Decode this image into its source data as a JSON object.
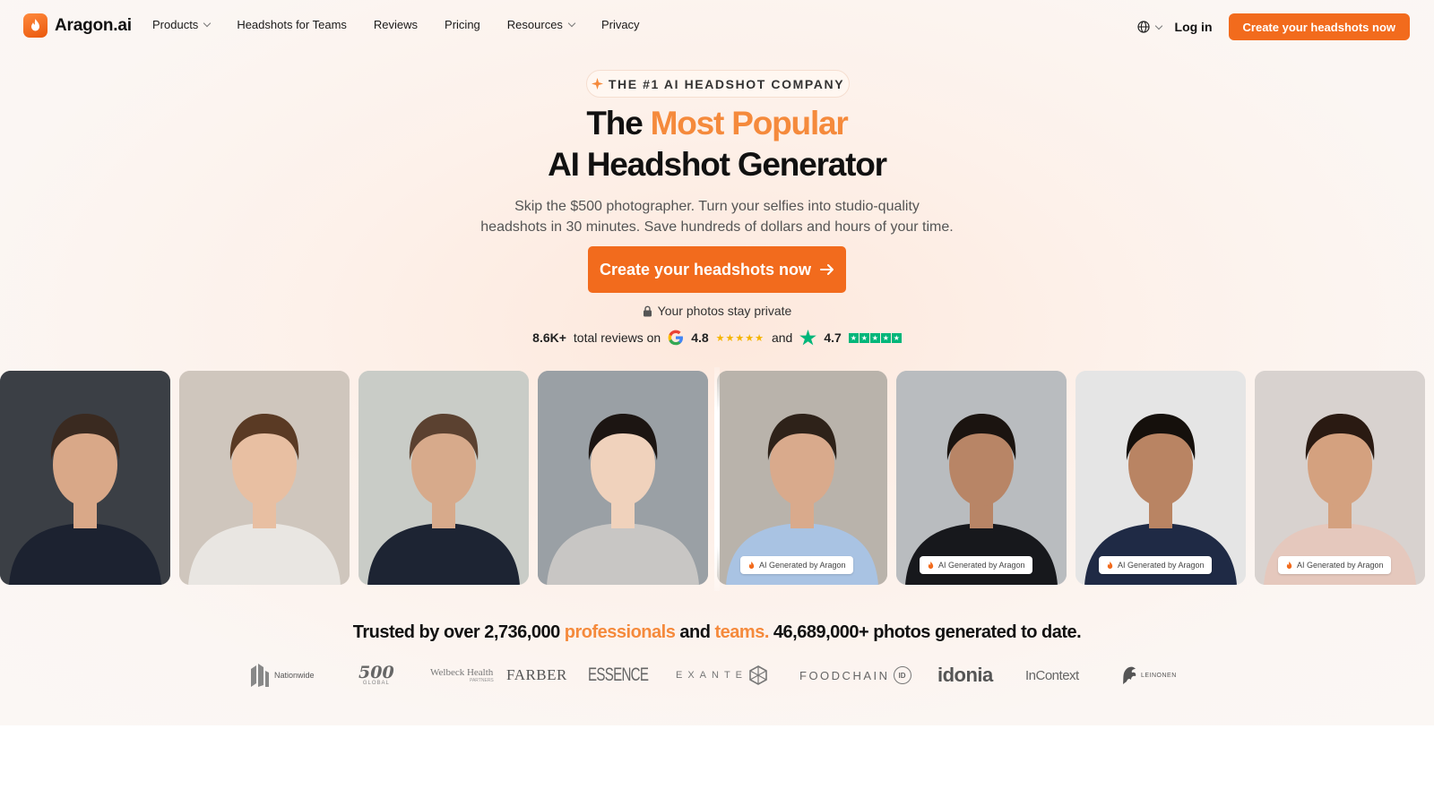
{
  "nav": {
    "brand": "Aragon.ai",
    "links": [
      {
        "label": "Products",
        "dropdown": true
      },
      {
        "label": "Headshots for Teams",
        "dropdown": false
      },
      {
        "label": "Reviews",
        "dropdown": false
      },
      {
        "label": "Pricing",
        "dropdown": false
      },
      {
        "label": "Resources",
        "dropdown": true
      },
      {
        "label": "Privacy",
        "dropdown": false
      }
    ],
    "login": "Log in",
    "cta": "Create your headshots now"
  },
  "hero": {
    "badge": "THE #1 AI HEADSHOT COMPANY",
    "title_pre": "The ",
    "title_accent": "Most Popular",
    "title_line2": "AI Headshot Generator",
    "subtitle_line1": "Skip the $500 photographer. Turn your selfies into studio-quality",
    "subtitle_line2": "headshots in 30 minutes. Save hundreds of dollars and hours of your time.",
    "cta": "Create your headshots now",
    "privacy_note": "Your photos stay private",
    "reviews": {
      "count": "8.6K+",
      "text": "total reviews on",
      "google_rating": "4.8",
      "and": "and",
      "trustpilot_rating": "4.7"
    }
  },
  "photos": {
    "ai_tag": "AI Generated by Aragon",
    "items": [
      {
        "kind": "selfie",
        "bg": "#3b3f45",
        "skin": "#d9a888",
        "hair": "#3a2a20",
        "shirt": "#1c2230"
      },
      {
        "kind": "selfie",
        "bg": "#cfc6bd",
        "skin": "#e8bfa2",
        "hair": "#5a3a24",
        "shirt": "#e9e6e2"
      },
      {
        "kind": "selfie",
        "bg": "#c9ccc7",
        "skin": "#d7aa8b",
        "hair": "#5b4130",
        "shirt": "#1d2433"
      },
      {
        "kind": "selfie",
        "bg": "#9aa0a5",
        "skin": "#f0d2bc",
        "hair": "#1c1512",
        "shirt": "#c8c6c4"
      },
      {
        "kind": "headshot",
        "bg": "#b9b3ab",
        "skin": "#d9aa8c",
        "hair": "#2e2219",
        "shirt": "#a9c3e3"
      },
      {
        "kind": "headshot",
        "bg": "#b9bcbf",
        "skin": "#b88566",
        "hair": "#1b1410",
        "shirt": "#17181c"
      },
      {
        "kind": "headshot",
        "bg": "#e5e5e5",
        "skin": "#b98463",
        "hair": "#15100c",
        "shirt": "#1f2a45"
      },
      {
        "kind": "headshot",
        "bg": "#d8d2cf",
        "skin": "#d4a17f",
        "hair": "#2a1a12",
        "shirt": "#e5c8bd"
      }
    ]
  },
  "trust": {
    "pre": "Trusted by over 2,736,000 ",
    "professionals": "professionals",
    "and": " and ",
    "teams": "teams.",
    "post": " 46,689,000+ photos generated to date."
  },
  "logos": [
    "Nationwide",
    "500",
    "GLOBAL",
    "Welbeck Health",
    "PARTNERS",
    "FARBER",
    "ESSENCE",
    "EXANTE",
    "FOODCHAIN",
    "ID",
    "idonia",
    "InContext",
    "LEINONEN"
  ],
  "colors": {
    "accent": "#f26b1d",
    "accent_text": "#f58a3c",
    "google_star": "#f5b400",
    "trustpilot": "#00b67a"
  }
}
